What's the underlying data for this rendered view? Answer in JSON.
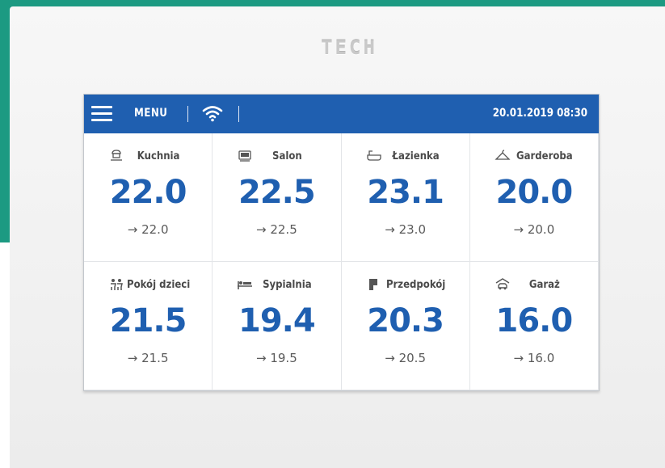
{
  "brand": {
    "logo_text": "TECH"
  },
  "header": {
    "menu_label": "MENU",
    "datetime": "20.01.2019 08:30",
    "bar_color": "#1f5fb0"
  },
  "zones": [
    {
      "name": "Kuchnia",
      "temp": "22.0",
      "setpoint": "→ 22.0",
      "icon": "kitchen-icon"
    },
    {
      "name": "Salon",
      "temp": "22.5",
      "setpoint": "→ 22.5",
      "icon": "sofa-icon"
    },
    {
      "name": "Łazienka",
      "temp": "23.1",
      "setpoint": "→ 23.0",
      "icon": "bathtub-icon"
    },
    {
      "name": "Garderoba",
      "temp": "20.0",
      "setpoint": "→ 20.0",
      "icon": "hanger-icon"
    },
    {
      "name": "Pokój dzieci",
      "temp": "21.5",
      "setpoint": "→ 21.5",
      "icon": "children-icon"
    },
    {
      "name": "Sypialnia",
      "temp": "19.4",
      "setpoint": "→ 19.5",
      "icon": "bed-icon"
    },
    {
      "name": "Przedpokój",
      "temp": "20.3",
      "setpoint": "→ 20.5",
      "icon": "door-icon"
    },
    {
      "name": "Garaż",
      "temp": "16.0",
      "setpoint": "→ 16.0",
      "icon": "car-icon"
    }
  ]
}
